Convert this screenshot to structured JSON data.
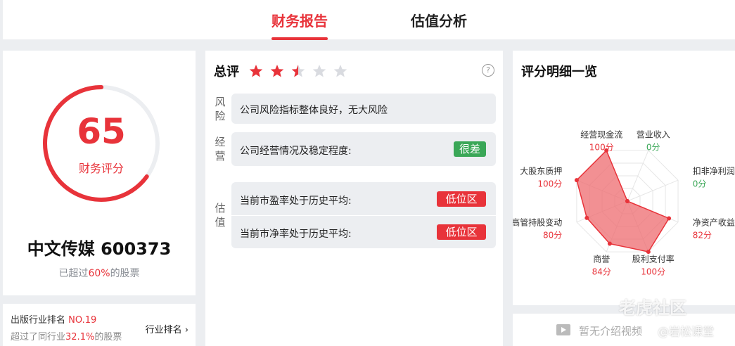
{
  "tabs": [
    {
      "label": "财务报告",
      "active": true
    },
    {
      "label": "估值分析",
      "active": false
    }
  ],
  "score": {
    "value": "65",
    "label": "财务评分",
    "progress_pct": 65
  },
  "stock": {
    "name_code": "中文传媒 600373"
  },
  "exceed": {
    "prefix": "已超过",
    "pct": "60%",
    "suffix": "的股票"
  },
  "rank": {
    "industry_prefix": "出版行业排名 ",
    "rank_no": "NO.19",
    "beat_prefix": "超过了同行业",
    "beat_pct": "32.1%",
    "beat_suffix": "的股票",
    "link_label": "行业排名"
  },
  "summary": {
    "title": "总评",
    "stars": 2.5,
    "stars_max": 5,
    "help_icon": "?",
    "risk_label": "风险",
    "risk_text": "公司风险指标整体良好，无大风险",
    "ops_label": "经营",
    "ops_text": "公司经营情况及稳定程度:",
    "ops_tag": "很差",
    "val_label": "估值",
    "pe_text": "当前市盈率处于历史平均:",
    "pe_tag": "低位区",
    "pb_text": "当前市净率处于历史平均:",
    "pb_tag": "低位区"
  },
  "detail": {
    "title": "评分明细一览",
    "items": [
      {
        "name": "营业收入",
        "value": "0分",
        "score": 0
      },
      {
        "name": "扣非净利润",
        "value": "0分",
        "score": 0
      },
      {
        "name": "净资产收益",
        "value": "82分",
        "score": 82
      },
      {
        "name": "股利支付率",
        "value": "100分",
        "score": 100
      },
      {
        "name": "商誉",
        "value": "84分",
        "score": 84
      },
      {
        "name": "高管持股变动",
        "value": "80分",
        "score": 80
      },
      {
        "name": "大股东质押",
        "value": "100分",
        "score": 100
      },
      {
        "name": "经营现金流",
        "value": "100分",
        "score": 100
      }
    ],
    "video_text": "暂无介绍视频"
  },
  "watermark": {
    "line1": "老虎社区",
    "line2": "@岩松课堂"
  },
  "colors": {
    "accent": "#e8333a",
    "green": "#3aa757",
    "radar_fill": "#ee6b6f"
  }
}
